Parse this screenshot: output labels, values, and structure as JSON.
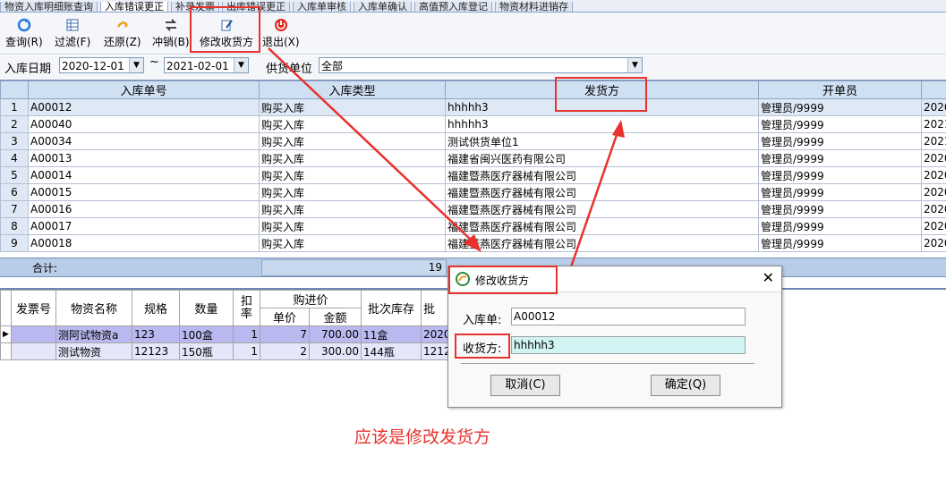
{
  "tabs": [
    "物资入库明细账查询",
    "入库错误更正",
    "补录发票",
    "出库错误更正",
    "入库单审核",
    "入库单确认",
    "高值预入库登记",
    "物资材料进销存"
  ],
  "toolbar": {
    "query": "查询(R)",
    "filter": "过滤(F)",
    "restore": "还原(Z)",
    "reverse": "冲销(B)",
    "edit_receiver": "修改收货方",
    "exit": "退出(X)"
  },
  "filter": {
    "date_label": "入库日期",
    "date_from": "2020-12-01",
    "tilde": "~",
    "date_to": "2021-02-01",
    "supplier_label": "供货单位",
    "supplier_value": "全部"
  },
  "grid1": {
    "headers": [
      "入库单号",
      "入库类型",
      "发货方",
      "开单员"
    ],
    "rows": [
      {
        "n": "1",
        "id": "A00012",
        "type": "购买入库",
        "sender": "hhhhh3",
        "clerk": "管理员/9999",
        "date": "2020"
      },
      {
        "n": "2",
        "id": "A00040",
        "type": "购买入库",
        "sender": "hhhhh3",
        "clerk": "管理员/9999",
        "date": "2021"
      },
      {
        "n": "3",
        "id": "A00034",
        "type": "购买入库",
        "sender": "测试供货单位1",
        "clerk": "管理员/9999",
        "date": "2021"
      },
      {
        "n": "4",
        "id": "A00013",
        "type": "购买入库",
        "sender": "福建省闽兴医药有限公司",
        "clerk": "管理员/9999",
        "date": "2020"
      },
      {
        "n": "5",
        "id": "A00014",
        "type": "购买入库",
        "sender": "福建暨燕医疗器械有限公司",
        "clerk": "管理员/9999",
        "date": "2020"
      },
      {
        "n": "6",
        "id": "A00015",
        "type": "购买入库",
        "sender": "福建暨燕医疗器械有限公司",
        "clerk": "管理员/9999",
        "date": "2020"
      },
      {
        "n": "7",
        "id": "A00016",
        "type": "购买入库",
        "sender": "福建暨燕医疗器械有限公司",
        "clerk": "管理员/9999",
        "date": "2020"
      },
      {
        "n": "8",
        "id": "A00017",
        "type": "购买入库",
        "sender": "福建暨燕医疗器械有限公司",
        "clerk": "管理员/9999",
        "date": "2020"
      },
      {
        "n": "9",
        "id": "A00018",
        "type": "购买入库",
        "sender": "福建暨燕医疗器械有限公司",
        "clerk": "管理员/9999",
        "date": "2020"
      }
    ],
    "total_label": "合计:",
    "total_count": "19"
  },
  "grid2": {
    "headers": {
      "invoice": "发票号",
      "name": "物资名称",
      "spec": "规格",
      "qty": "数量",
      "discount": "扣率",
      "purchase": "购进价",
      "unit_price": "单价",
      "amount": "金额",
      "batch": "批次库存",
      "batch2": "批"
    },
    "rows": [
      {
        "name": "测阿试物资a",
        "spec": "123",
        "qty": "100盒",
        "disc": "1",
        "price": "7",
        "amount": "700.00",
        "batch": "11盒",
        "more": "2020"
      },
      {
        "name": "测试物资",
        "spec": "12123",
        "qty": "150瓶",
        "disc": "1",
        "price": "2",
        "amount": "300.00",
        "batch": "144瓶",
        "more": "1212"
      }
    ]
  },
  "dialog": {
    "title": "修改收货方",
    "order_label": "入库单:",
    "order_value": "A00012",
    "receiver_label": "收货方:",
    "receiver_value": "hhhhh3",
    "cancel": "取消(C)",
    "ok": "确定(Q)"
  },
  "annotation": "应该是修改发货方",
  "colors": {
    "annotation_red": "#e8322d",
    "grid_header": "#cfe0f3",
    "selected_row": "#b9b9f0"
  }
}
